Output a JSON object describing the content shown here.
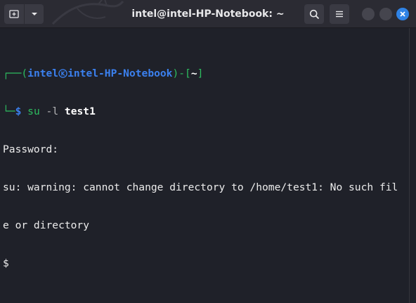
{
  "window": {
    "title": "intel@intel-HP-Notebook: ~"
  },
  "header": {
    "new_tab_icon": "new-tab-icon",
    "dropdown_icon": "chevron-down-icon",
    "search_icon": "search-icon",
    "menu_icon": "hamburger-menu-icon",
    "close_icon": "close-icon"
  },
  "terminal": {
    "prompt": {
      "open": "┌──(",
      "user": "intel",
      "host": "intel-HP-Notebook",
      "mid": ")-[",
      "cwd": "~",
      "close": "]",
      "corner": "└─",
      "dollar": "$",
      "cmd": "su",
      "flag": "-l",
      "arg": "test1"
    },
    "lines": [
      "Password:",
      "su: warning: cannot change directory to /home/test1: No such fil",
      "e or directory",
      "$"
    ]
  },
  "colors": {
    "background": "#1f2129",
    "titlebar": "#2b2b33",
    "prompt_green": "#2dbe60",
    "prompt_blue": "#3b80ee",
    "close_button": "#2f83e6"
  }
}
